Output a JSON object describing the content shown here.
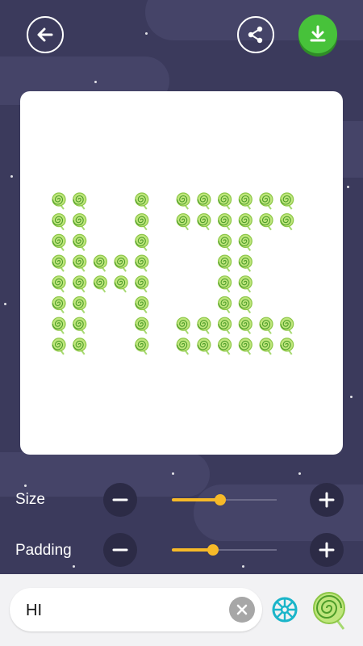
{
  "header": {
    "back_icon": "arrow-left-icon",
    "share_icon": "share-icon",
    "download_icon": "download-icon",
    "accent_color": "#47c23a"
  },
  "preview": {
    "emoji": "lollipop",
    "text": "HI",
    "background_color": "#ffffff"
  },
  "controls": {
    "size": {
      "label": "Size",
      "value": 0.46
    },
    "padding": {
      "label": "Padding",
      "value": 0.39
    },
    "slider_color": "#f6b928"
  },
  "input": {
    "value": "HI",
    "clear_icon": "close-icon"
  },
  "tools": {
    "palette_icon": "color-wheel-icon",
    "emoji_icon": "lollipop-icon"
  }
}
